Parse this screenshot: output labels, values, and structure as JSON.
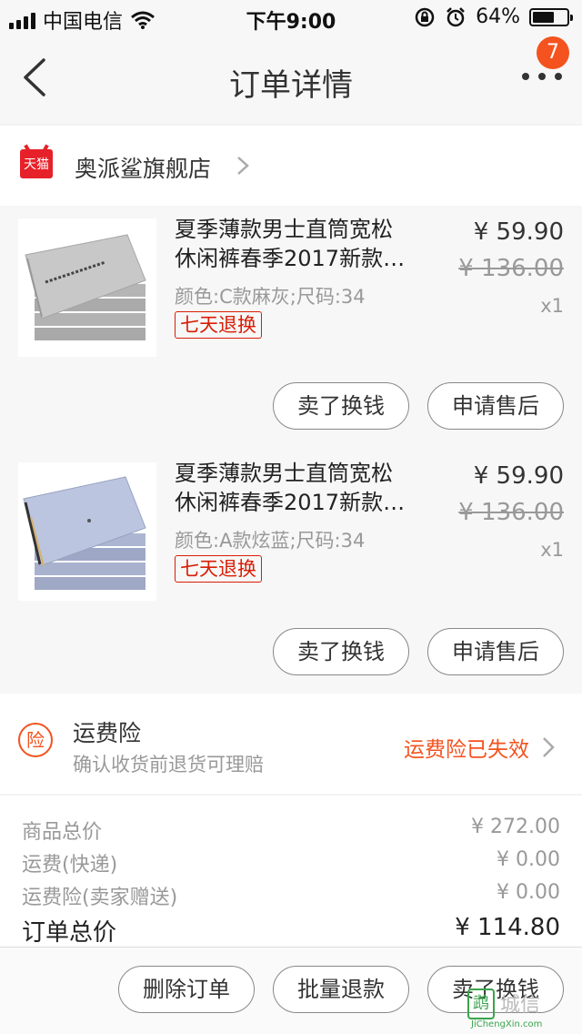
{
  "status_bar": {
    "carrier": "中国电信",
    "time": "下午9:00",
    "battery_text": "64%",
    "battery_level": 0.64
  },
  "nav": {
    "title": "订单详情",
    "badge_count": "7",
    "back_icon": "chevron-left-icon",
    "more_icon": "more-dots-icon"
  },
  "shop": {
    "logo_text": "天猫",
    "name": "奥派鲨旗舰店"
  },
  "items": [
    {
      "title_line1": "夏季薄款男士直筒宽松",
      "title_line2": "休闲裤春季2017新款…",
      "sku": "颜色:C款麻灰;尺码:34",
      "tag": "七天退换",
      "price": "¥ 59.90",
      "original_price": "¥ 136.00",
      "quantity": "x1",
      "btn_sell": "卖了换钱",
      "btn_aftersale": "申请售后",
      "thumb_color": "#b8b8b8"
    },
    {
      "title_line1": "夏季薄款男士直筒宽松",
      "title_line2": "休闲裤春季2017新款…",
      "sku": "颜色:A款炫蓝;尺码:34",
      "tag": "七天退换",
      "price": "¥ 59.90",
      "original_price": "¥ 136.00",
      "quantity": "x1",
      "btn_sell": "卖了换钱",
      "btn_aftersale": "申请售后",
      "thumb_color": "#aeb9d6"
    }
  ],
  "insurance": {
    "icon_text": "险",
    "title": "运费险",
    "desc": "确认收货前退货可理赔",
    "status": "运费险已失效"
  },
  "summary": [
    {
      "label": "商品总价",
      "value": "¥ 272.00"
    },
    {
      "label": "运费(快递)",
      "value": "¥ 0.00"
    },
    {
      "label": "运费险(卖家赠送)",
      "value": "¥ 0.00"
    },
    {
      "label": "订单总价",
      "value": "¥ 114.80"
    }
  ],
  "footer": {
    "delete": "删除订单",
    "batch_refund": "批量退款",
    "sell": "卖了换钱"
  },
  "watermark": {
    "logo": "鹉",
    "text": "城信",
    "url": "JiChengXin.com"
  },
  "colors": {
    "accent": "#f4531f",
    "tmall_red": "#e62129",
    "tag_red": "#d81e06"
  }
}
